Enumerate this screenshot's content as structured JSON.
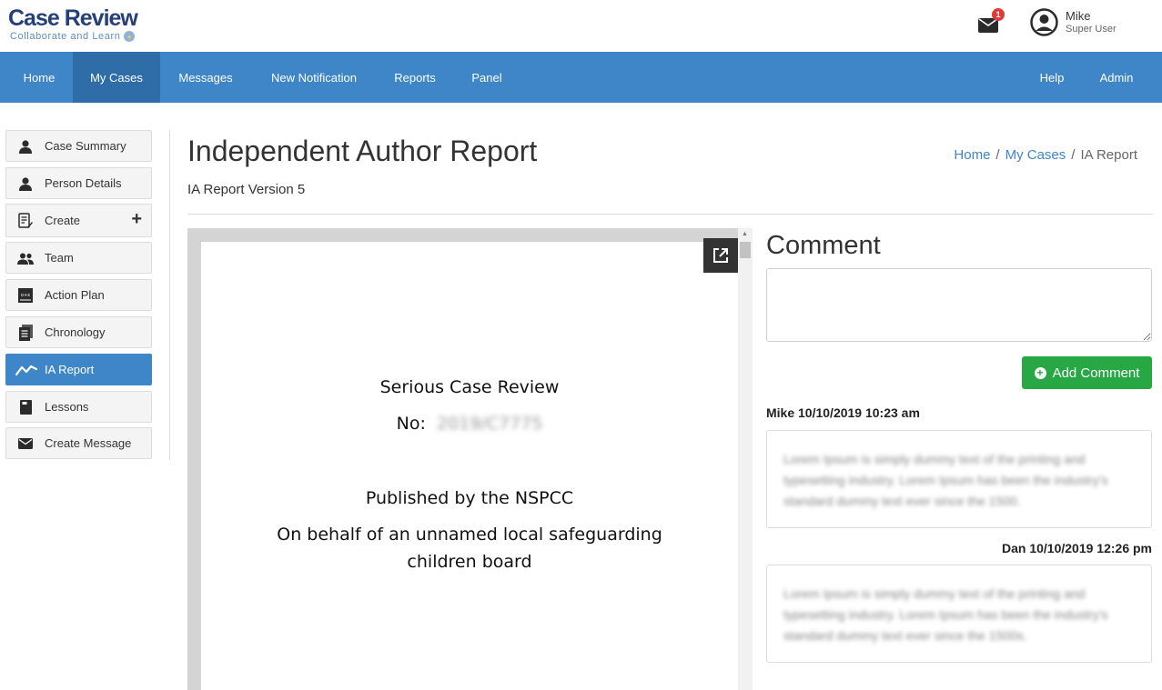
{
  "header": {
    "logo_title": "Case Review",
    "logo_subtitle": "Collaborate and Learn",
    "notification_count": "1",
    "user_name": "Mike",
    "user_role": "Super User"
  },
  "nav": {
    "items": [
      {
        "label": "Home",
        "active": false
      },
      {
        "label": "My Cases",
        "active": true
      },
      {
        "label": "Messages",
        "active": false
      },
      {
        "label": "New Notification",
        "active": false
      },
      {
        "label": "Reports",
        "active": false
      },
      {
        "label": "Panel",
        "active": false
      },
      {
        "label": "Help",
        "active": false
      },
      {
        "label": "Admin",
        "active": false
      }
    ]
  },
  "sidebar": {
    "items": [
      {
        "label": "Case Summary",
        "icon": "person-icon"
      },
      {
        "label": "Person Details",
        "icon": "person-icon"
      },
      {
        "label": "Create",
        "icon": "edit-document-icon",
        "action": "+"
      },
      {
        "label": "Team",
        "icon": "team-icon"
      },
      {
        "label": "Action Plan",
        "icon": "action-plan-icon"
      },
      {
        "label": "Chronology",
        "icon": "chronology-icon"
      },
      {
        "label": "IA Report",
        "icon": "chart-line-icon",
        "active": true
      },
      {
        "label": "Lessons",
        "icon": "book-icon"
      },
      {
        "label": "Create Message",
        "icon": "envelope-icon"
      }
    ]
  },
  "page": {
    "title": "Independent Author Report",
    "subtitle": "IA Report Version 5",
    "breadcrumb": {
      "home": "Home",
      "separator": "/",
      "cases": "My Cases",
      "current": "IA Report"
    }
  },
  "document": {
    "line1": "Serious Case Review",
    "no_label": "No:",
    "no_value": "2019/C7775",
    "line3": "Published by the NSPCC",
    "line4": "On behalf of an unnamed local safeguarding",
    "line5": "children board"
  },
  "comments": {
    "title": "Comment",
    "input_value": "",
    "add_button": "Add Comment",
    "entries": [
      {
        "author_time": "Mike 10/10/2019 10:23 am",
        "text": "Lorem Ipsum is simply dummy text of the printing and typesetting industry. Lorem Ipsum has been the industry's standard dummy text ever since the 1500."
      },
      {
        "author_time": "Dan 10/10/2019 12:26 pm",
        "text": "Lorem Ipsum is simply dummy text of the printing and typesetting industry. Lorem Ipsum has been the industry's standard dummy text ever since the 1500s."
      }
    ]
  },
  "colors": {
    "nav_bg": "#3e86c8",
    "nav_active": "#2f6da8",
    "add_button": "#28a745",
    "badge": "#e03b3b"
  }
}
